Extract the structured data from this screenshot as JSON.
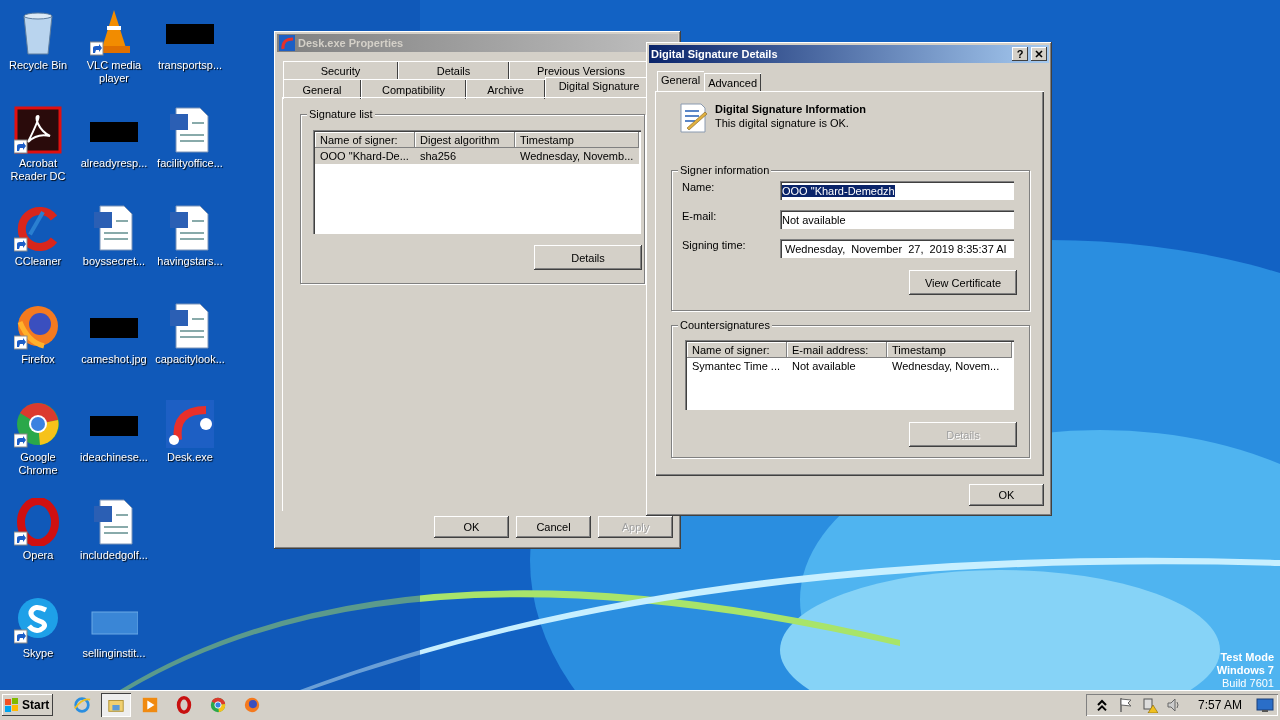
{
  "desktop_icons": [
    {
      "label": "Recycle Bin",
      "kind": "recycle",
      "shortcut": false
    },
    {
      "label": "Acrobat Reader DC",
      "kind": "acrobat",
      "shortcut": true
    },
    {
      "label": "CCleaner",
      "kind": "ccleaner",
      "shortcut": true
    },
    {
      "label": "Firefox",
      "kind": "firefox",
      "shortcut": true
    },
    {
      "label": "Google Chrome",
      "kind": "chrome",
      "shortcut": true
    },
    {
      "label": "Opera",
      "kind": "opera",
      "shortcut": true
    },
    {
      "label": "Skype",
      "kind": "skype",
      "shortcut": true
    },
    {
      "label": "VLC media player",
      "kind": "vlc",
      "shortcut": true
    },
    {
      "label": "alreadyresp...",
      "kind": "redacted",
      "shortcut": false
    },
    {
      "label": "boyssecret...",
      "kind": "word",
      "shortcut": false
    },
    {
      "label": "cameshot.jpg",
      "kind": "redacted",
      "shortcut": false
    },
    {
      "label": "ideachinese...",
      "kind": "redacted",
      "shortcut": false
    },
    {
      "label": "includedgolf...",
      "kind": "word",
      "shortcut": false
    },
    {
      "label": "sellinginstit...",
      "kind": "blank",
      "shortcut": false
    },
    {
      "label": "transportsp...",
      "kind": "redacted",
      "shortcut": false
    },
    {
      "label": "facilityoffice...",
      "kind": "word",
      "shortcut": false
    },
    {
      "label": "havingstars...",
      "kind": "word",
      "shortcut": false
    },
    {
      "label": "capacitylook...",
      "kind": "word",
      "shortcut": false
    },
    {
      "label": "Desk.exe",
      "kind": "desk",
      "shortcut": false
    }
  ],
  "properties_window": {
    "title": "Desk.exe Properties",
    "tab_rows": [
      [
        {
          "label": "Security",
          "selected": false
        },
        {
          "label": "Details",
          "selected": false
        },
        {
          "label": "Previous Versions",
          "selected": false
        }
      ],
      [
        {
          "label": "General",
          "selected": false
        },
        {
          "label": "Compatibility",
          "selected": false
        },
        {
          "label": "Archive",
          "selected": false
        },
        {
          "label": "Digital Signature",
          "selected": true
        }
      ]
    ],
    "group_title": "Signature list",
    "columns": [
      "Name of signer:",
      "Digest algorithm",
      "Timestamp"
    ],
    "rows": [
      {
        "cells": [
          "OOO \"Khard-De...",
          "sha256",
          "Wednesday, Novemb..."
        ],
        "selected": true
      }
    ],
    "details_button": "Details",
    "buttons": [
      {
        "label": "OK",
        "disabled": false
      },
      {
        "label": "Cancel",
        "disabled": false
      },
      {
        "label": "Apply",
        "disabled": true
      }
    ]
  },
  "signature_dialog": {
    "title": "Digital Signature Details",
    "help": "?",
    "tabs": [
      {
        "label": "General",
        "selected": true
      },
      {
        "label": "Advanced",
        "selected": false
      }
    ],
    "heading": "Digital Signature Information",
    "status": "This digital signature is OK.",
    "signer_group": "Signer information",
    "fields": [
      {
        "label": "Name:",
        "value": "OOO \"Khard-Demedzh",
        "selected": true
      },
      {
        "label": "E-mail:",
        "value": "Not available",
        "selected": false
      },
      {
        "label": "Signing time:",
        "value": " Wednesday,  November  27,  2019 8:35:37 AI",
        "selected": false
      }
    ],
    "view_certificate": "View Certificate",
    "countersign_group": "Countersignatures",
    "columns": [
      "Name of signer:",
      "E-mail address:",
      "Timestamp"
    ],
    "rows": [
      {
        "cells": [
          "Symantec Time ...",
          "Not available",
          "Wednesday, Novem..."
        ]
      }
    ],
    "details_button": {
      "label": "Details",
      "disabled": true
    },
    "ok": "OK"
  },
  "desktop_notice": [
    "Test Mode",
    "Windows 7",
    "Build 7601"
  ],
  "taskbar": {
    "start": "Start",
    "apps": [
      {
        "kind": "ie",
        "active": false
      },
      {
        "kind": "explorer",
        "active": true
      },
      {
        "kind": "media",
        "active": false
      },
      {
        "kind": "opera",
        "active": false
      },
      {
        "kind": "chrome",
        "active": false
      },
      {
        "kind": "firefox",
        "active": false
      }
    ],
    "clock": "7:57 AM"
  }
}
